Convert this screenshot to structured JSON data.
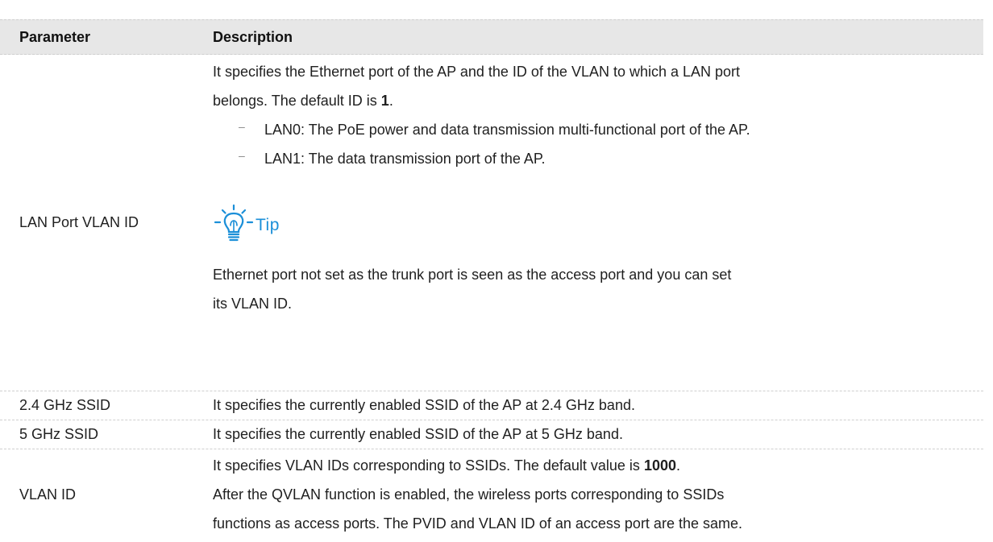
{
  "table": {
    "header": {
      "parameter": "Parameter",
      "description": "Description"
    },
    "lan_port": {
      "parameter": "LAN Port VLAN ID",
      "desc_line1": "It specifies the Ethernet port of the AP and the ID of the VLAN to which a LAN port",
      "desc_line2_prefix": "belongs. The default ID is ",
      "desc_line2_bold": "1",
      "desc_line2_suffix": ".",
      "bullet_marker": "–",
      "bullets": [
        "LAN0: The PoE power and data transmission multi-functional port of the AP.",
        "LAN1: The data transmission port of the AP."
      ],
      "tip_label": "Tip",
      "tip_line1": "Ethernet port not set as the trunk port is seen as the access port and you can set",
      "tip_line2": "its VLAN ID."
    },
    "ssid_24": {
      "parameter": "2.4 GHz SSID",
      "description": "It specifies the currently enabled SSID of the AP at 2.4 GHz band."
    },
    "ssid_5": {
      "parameter": "5 GHz SSID",
      "description": "It specifies the currently enabled SSID of the AP at 5 GHz band."
    },
    "vlan_id": {
      "parameter": "VLAN ID",
      "desc_line1_prefix": "It specifies VLAN IDs corresponding to SSIDs. The default value is ",
      "desc_line1_bold": "1000",
      "desc_line1_suffix": ".",
      "desc_line2": "After the QVLAN function is enabled, the wireless ports corresponding to SSIDs",
      "desc_line3": "functions as access ports. The PVID and VLAN ID of an access port are the same."
    }
  },
  "colors": {
    "header_bg": "#e7e7e7",
    "tip_blue": "#1b8fd8",
    "divider": "#cfcfcf"
  },
  "icons": {
    "tip": "lightbulb-icon"
  }
}
